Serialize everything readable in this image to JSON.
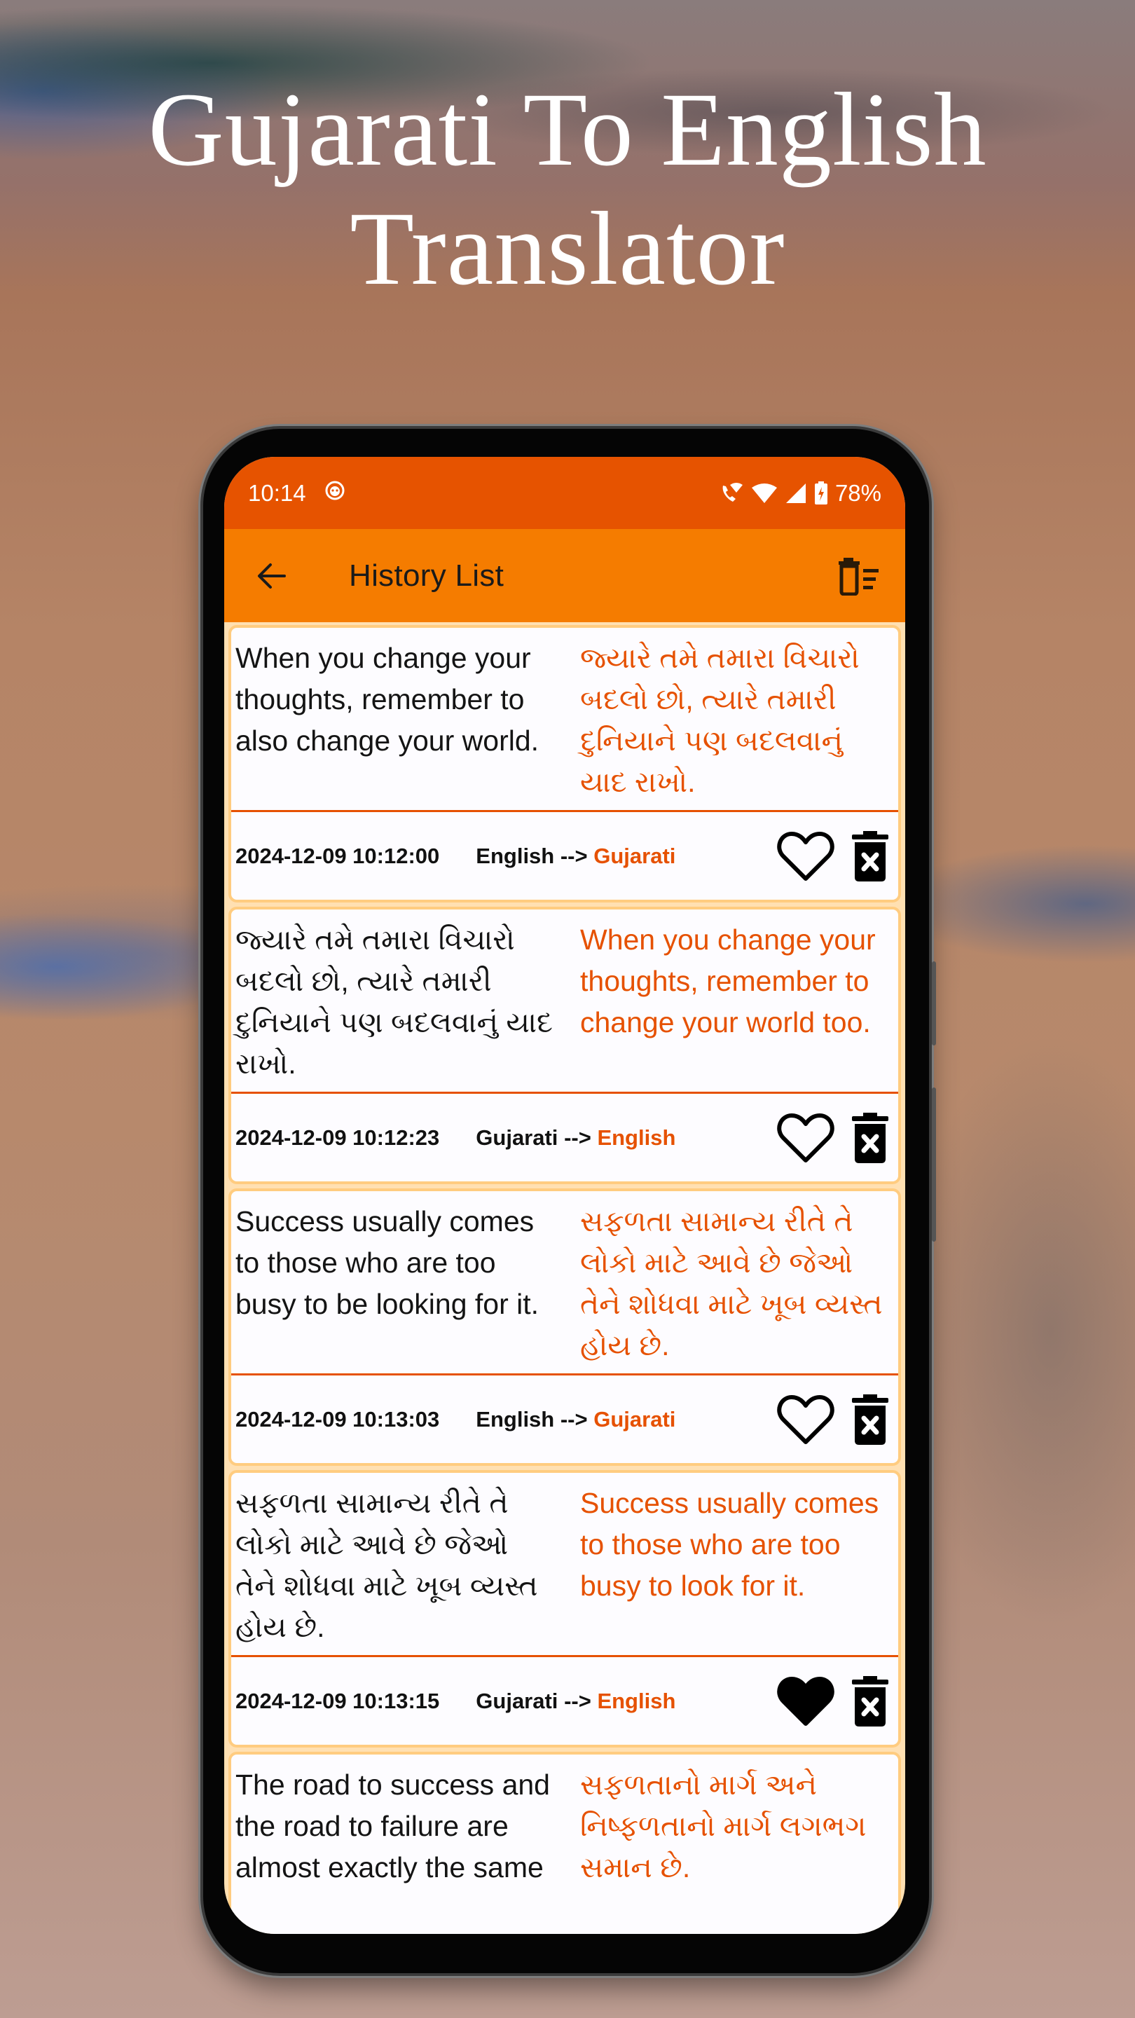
{
  "headline": {
    "line1": "Gujarati To English",
    "line2": "Translator"
  },
  "status_bar": {
    "time": "10:14",
    "notification_icon": "app-notification-icon",
    "icons": [
      "wifi-calling-icon",
      "wifi-icon",
      "cellular-signal-icon",
      "battery-charging-icon"
    ],
    "battery": "78%"
  },
  "toolbar": {
    "back_icon": "arrow-left-icon",
    "title": "History List",
    "clear_all_icon": "delete-sweep-icon"
  },
  "colors": {
    "status_bar": "#E65300",
    "toolbar": "#F57C00",
    "accent_text": "#E65100",
    "card_border": "#FFCC80",
    "card_background": "#FDFCFF"
  },
  "history": [
    {
      "source_text": "When you change your thoughts, remember to also change your world.",
      "translated_text": "જ્યારે તમે તમારા વિચારો બદલો છો, ત્યારે તમારી દુનિયાને પણ બદલવાનું યાદ રાખો.",
      "timestamp": "2024-12-09 10:12:00",
      "from_lang": "English",
      "arrow": "-->",
      "to_lang": "Gujarati",
      "favorite": false
    },
    {
      "source_text": "જ્યારે તમે તમારા વિચારો બદલો છો, ત્યારે તમારી દુનિયાને પણ બદલવાનું યાદ રાખો.",
      "translated_text": "When you change your thoughts, remember to change your world too.",
      "timestamp": "2024-12-09 10:12:23",
      "from_lang": "Gujarati",
      "arrow": "-->",
      "to_lang": "English",
      "favorite": false
    },
    {
      "source_text": "Success usually comes to those who are too busy to be looking for it.",
      "translated_text": "સફળતા સામાન્ય રીતે તે લોકો માટે આવે છે જેઓ તેને શોધવા માટે ખૂબ વ્યસ્ત હોય છે.",
      "timestamp": "2024-12-09 10:13:03",
      "from_lang": "English",
      "arrow": "-->",
      "to_lang": "Gujarati",
      "favorite": false
    },
    {
      "source_text": "સફળતા સામાન્ય રીતે તે લોકો માટે આવે છે જેઓ તેને શોધવા માટે ખૂબ વ્યસ્ત હોય છે.",
      "translated_text": "Success usually comes to those who are too busy to look for it.",
      "timestamp": "2024-12-09 10:13:15",
      "from_lang": "Gujarati",
      "arrow": "-->",
      "to_lang": "English",
      "favorite": true
    },
    {
      "source_text": "The road to success and the road to failure are almost exactly the same",
      "translated_text": "સફળતાનો માર્ગ અને નિષ્ફળતાનો માર્ગ લગભગ સમાન છે."
    }
  ]
}
